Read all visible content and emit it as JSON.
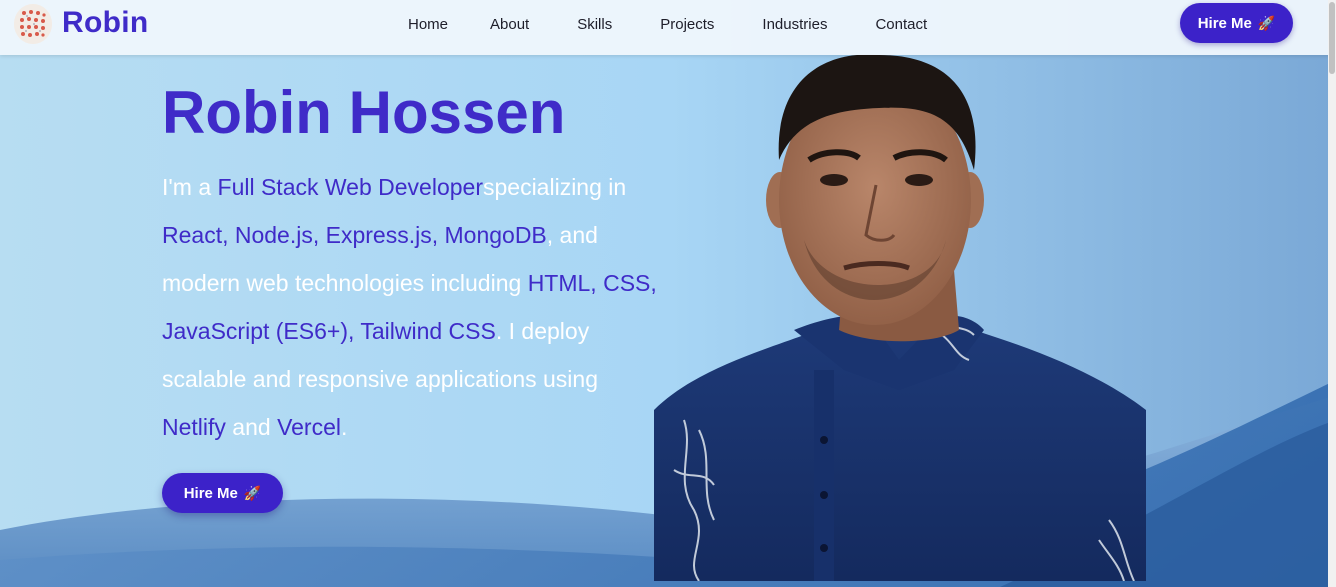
{
  "brand": {
    "name": "Robin"
  },
  "nav": {
    "items": [
      "Home",
      "About",
      "Skills",
      "Projects",
      "Industries",
      "Contact"
    ],
    "hire_label": "Hire Me",
    "hire_icon": "rocket-icon"
  },
  "hero": {
    "name": "Robin Hossen",
    "intro_1": "I'm a ",
    "role": "Full Stack Web Developer",
    "intro_2": "specializing in ",
    "stack_1": "React, Node.js, Express.js, MongoDB",
    "intro_3": ", and modern web technologies including ",
    "stack_2": "HTML, CSS, JavaScript (ES6+), Tailwind CSS",
    "intro_4": ". I deploy scalable and responsive applications using ",
    "host_1": "Netlify",
    "intro_5": " and ",
    "host_2": "Vercel",
    "intro_6": ".",
    "hire_label": "Hire Me"
  },
  "colors": {
    "accent": "#3c22c9",
    "heading": "#3f2bc8",
    "sky": "#a9d6f3",
    "wave": "#3a6fb0"
  }
}
